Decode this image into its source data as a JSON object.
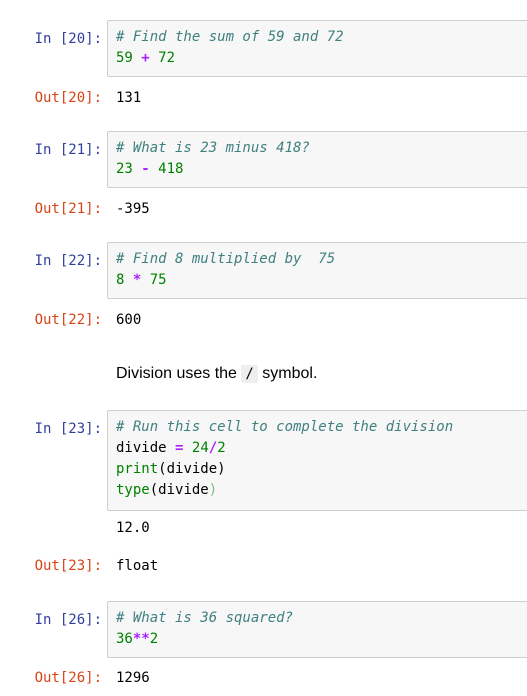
{
  "cells": [
    {
      "in_prompt": "In [20]:",
      "comment": "# Find the sum of 59 and 72",
      "code_a": "59",
      "code_op": "+",
      "code_b": "72",
      "out_prompt": "Out[20]:",
      "output": "131"
    },
    {
      "in_prompt": "In [21]:",
      "comment": "# What is 23 minus 418?",
      "code_a": "23",
      "code_op": "-",
      "code_b": "418",
      "out_prompt": "Out[21]:",
      "output": "-395"
    },
    {
      "in_prompt": "In [22]:",
      "comment": "# Find 8 multiplied by  75",
      "code_a": "8",
      "code_op": "*",
      "code_b": "75",
      "out_prompt": "Out[22]:",
      "output": "600"
    }
  ],
  "markdown": {
    "before": "Division uses the",
    "code": "/",
    "after": "symbol."
  },
  "cell23": {
    "in_prompt": "In [23]:",
    "comment": "# Run this cell to complete the division",
    "line2_var": "divide",
    "line2_eq": "=",
    "line2_a": "24",
    "line2_op": "/",
    "line2_b": "2",
    "line3_fn": "print",
    "line3_arg": "divide",
    "line4_fn": "type",
    "line4_arg": "divide",
    "stdout": "12.0",
    "out_prompt": "Out[23]:",
    "output": "float"
  },
  "cell26": {
    "in_prompt": "In [26]:",
    "comment": "# What is 36 squared?",
    "code_a": "36",
    "code_op": "**",
    "code_b": "2",
    "out_prompt": "Out[26]:",
    "output": "1296"
  }
}
